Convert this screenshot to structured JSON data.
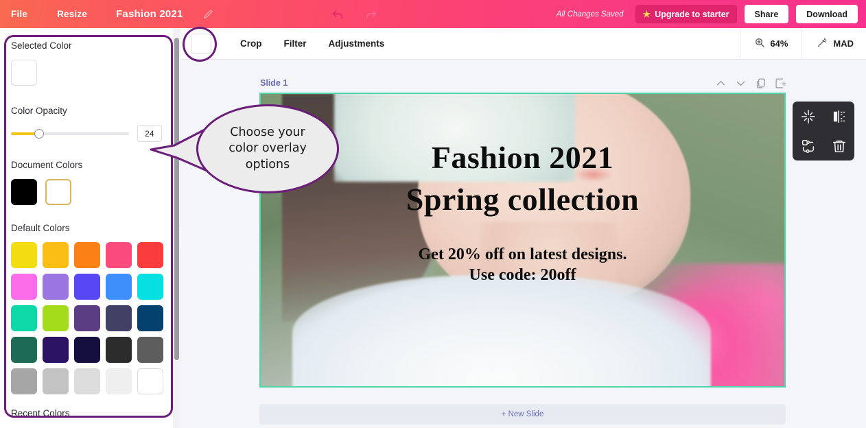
{
  "topbar": {
    "file": "File",
    "resize": "Resize",
    "title": "Fashion 2021",
    "pencil_icon": "pencil-icon",
    "undo_icon": "undo-icon",
    "redo_icon": "redo-icon",
    "saved_status": "All Changes Saved",
    "upgrade": "Upgrade to starter",
    "star_icon": "star-icon",
    "share": "Share",
    "download": "Download",
    "gradient_start": "#f9694f",
    "gradient_end": "#f7318e",
    "upgrade_bg": "#e0246b"
  },
  "subbar": {
    "color_swatch": "#ffffff",
    "crop": "Crop",
    "filter": "Filter",
    "adjustments": "Adjustments",
    "zoom_icon": "zoom-in-icon",
    "zoom_level": "64%",
    "magic_icon": "magic-wand-icon",
    "mad": "MAD"
  },
  "sidebar": {
    "selected_color_label": "Selected Color",
    "selected_color": "#ffffff",
    "opacity_label": "Color Opacity",
    "opacity_value": "24",
    "opacity_percent": 24,
    "slider_fill_color": "#f5c518",
    "document_colors_label": "Document Colors",
    "document_colors": [
      {
        "hex": "#000000",
        "selected": false
      },
      {
        "hex": "#ffffff",
        "selected": true
      }
    ],
    "default_colors_label": "Default Colors",
    "default_colors": [
      [
        "#f2dd12",
        "#fbbe14",
        "#fb8117",
        "#fb4a7d",
        "#fb3c3c"
      ],
      [
        "#fb6ce8",
        "#9b76e0",
        "#5847f5",
        "#3e8efb",
        "#07e0e0"
      ],
      [
        "#0dd8a8",
        "#a4dc1c",
        "#5b3d84",
        "#414166",
        "#04416f"
      ],
      [
        "#1d6a55",
        "#2b1263",
        "#150f3f",
        "#2c2c2c",
        "#5d5d5d"
      ],
      [
        "#a6a6a6",
        "#c3c3c3",
        "#dcdcdc",
        "#efefef",
        "#ffffff"
      ]
    ],
    "recent_colors_label": "Recent Colors",
    "collapse_icon": "chevron-left-icon",
    "scrollbar": "panel-scrollbar"
  },
  "main": {
    "slide_name": "Slide 1",
    "slide_tools": [
      {
        "icon": "chevron-up-icon",
        "name": "move-slide-up"
      },
      {
        "icon": "chevron-down-icon",
        "name": "move-slide-down"
      },
      {
        "icon": "duplicate-icon",
        "name": "duplicate-slide"
      },
      {
        "icon": "add-slide-icon",
        "name": "add-slide"
      }
    ],
    "canvas": {
      "border_color": "#4dd7a8",
      "heading_line1": "Fashion 2021",
      "heading_line2": "Spring collection",
      "sub_line1": "Get 20% off on latest designs.",
      "sub_line2": "Use code: 20off"
    },
    "float_tools": [
      {
        "icon": "fit-to-frame-icon",
        "name": "fit-image"
      },
      {
        "icon": "flip-horizontal-icon",
        "name": "flip-image"
      },
      {
        "icon": "replace-image-icon",
        "name": "replace-image"
      },
      {
        "icon": "trash-icon",
        "name": "delete-image"
      }
    ],
    "new_slide": "+ New Slide"
  },
  "annotations": {
    "callout_text": "Choose your color overlay options",
    "highlight_color": "#6b1d7a"
  }
}
